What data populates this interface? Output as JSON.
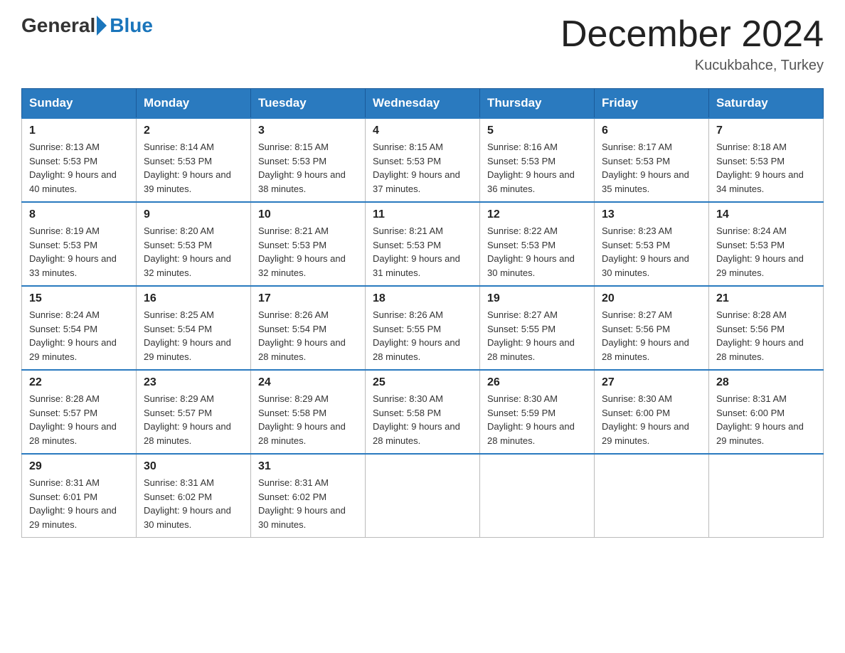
{
  "header": {
    "logo": {
      "general": "General",
      "blue": "Blue"
    },
    "title": "December 2024",
    "location": "Kucukbahce, Turkey"
  },
  "days_of_week": [
    "Sunday",
    "Monday",
    "Tuesday",
    "Wednesday",
    "Thursday",
    "Friday",
    "Saturday"
  ],
  "weeks": [
    [
      {
        "day": 1,
        "sunrise": "8:13 AM",
        "sunset": "5:53 PM",
        "daylight": "9 hours and 40 minutes."
      },
      {
        "day": 2,
        "sunrise": "8:14 AM",
        "sunset": "5:53 PM",
        "daylight": "9 hours and 39 minutes."
      },
      {
        "day": 3,
        "sunrise": "8:15 AM",
        "sunset": "5:53 PM",
        "daylight": "9 hours and 38 minutes."
      },
      {
        "day": 4,
        "sunrise": "8:15 AM",
        "sunset": "5:53 PM",
        "daylight": "9 hours and 37 minutes."
      },
      {
        "day": 5,
        "sunrise": "8:16 AM",
        "sunset": "5:53 PM",
        "daylight": "9 hours and 36 minutes."
      },
      {
        "day": 6,
        "sunrise": "8:17 AM",
        "sunset": "5:53 PM",
        "daylight": "9 hours and 35 minutes."
      },
      {
        "day": 7,
        "sunrise": "8:18 AM",
        "sunset": "5:53 PM",
        "daylight": "9 hours and 34 minutes."
      }
    ],
    [
      {
        "day": 8,
        "sunrise": "8:19 AM",
        "sunset": "5:53 PM",
        "daylight": "9 hours and 33 minutes."
      },
      {
        "day": 9,
        "sunrise": "8:20 AM",
        "sunset": "5:53 PM",
        "daylight": "9 hours and 32 minutes."
      },
      {
        "day": 10,
        "sunrise": "8:21 AM",
        "sunset": "5:53 PM",
        "daylight": "9 hours and 32 minutes."
      },
      {
        "day": 11,
        "sunrise": "8:21 AM",
        "sunset": "5:53 PM",
        "daylight": "9 hours and 31 minutes."
      },
      {
        "day": 12,
        "sunrise": "8:22 AM",
        "sunset": "5:53 PM",
        "daylight": "9 hours and 30 minutes."
      },
      {
        "day": 13,
        "sunrise": "8:23 AM",
        "sunset": "5:53 PM",
        "daylight": "9 hours and 30 minutes."
      },
      {
        "day": 14,
        "sunrise": "8:24 AM",
        "sunset": "5:53 PM",
        "daylight": "9 hours and 29 minutes."
      }
    ],
    [
      {
        "day": 15,
        "sunrise": "8:24 AM",
        "sunset": "5:54 PM",
        "daylight": "9 hours and 29 minutes."
      },
      {
        "day": 16,
        "sunrise": "8:25 AM",
        "sunset": "5:54 PM",
        "daylight": "9 hours and 29 minutes."
      },
      {
        "day": 17,
        "sunrise": "8:26 AM",
        "sunset": "5:54 PM",
        "daylight": "9 hours and 28 minutes."
      },
      {
        "day": 18,
        "sunrise": "8:26 AM",
        "sunset": "5:55 PM",
        "daylight": "9 hours and 28 minutes."
      },
      {
        "day": 19,
        "sunrise": "8:27 AM",
        "sunset": "5:55 PM",
        "daylight": "9 hours and 28 minutes."
      },
      {
        "day": 20,
        "sunrise": "8:27 AM",
        "sunset": "5:56 PM",
        "daylight": "9 hours and 28 minutes."
      },
      {
        "day": 21,
        "sunrise": "8:28 AM",
        "sunset": "5:56 PM",
        "daylight": "9 hours and 28 minutes."
      }
    ],
    [
      {
        "day": 22,
        "sunrise": "8:28 AM",
        "sunset": "5:57 PM",
        "daylight": "9 hours and 28 minutes."
      },
      {
        "day": 23,
        "sunrise": "8:29 AM",
        "sunset": "5:57 PM",
        "daylight": "9 hours and 28 minutes."
      },
      {
        "day": 24,
        "sunrise": "8:29 AM",
        "sunset": "5:58 PM",
        "daylight": "9 hours and 28 minutes."
      },
      {
        "day": 25,
        "sunrise": "8:30 AM",
        "sunset": "5:58 PM",
        "daylight": "9 hours and 28 minutes."
      },
      {
        "day": 26,
        "sunrise": "8:30 AM",
        "sunset": "5:59 PM",
        "daylight": "9 hours and 28 minutes."
      },
      {
        "day": 27,
        "sunrise": "8:30 AM",
        "sunset": "6:00 PM",
        "daylight": "9 hours and 29 minutes."
      },
      {
        "day": 28,
        "sunrise": "8:31 AM",
        "sunset": "6:00 PM",
        "daylight": "9 hours and 29 minutes."
      }
    ],
    [
      {
        "day": 29,
        "sunrise": "8:31 AM",
        "sunset": "6:01 PM",
        "daylight": "9 hours and 29 minutes."
      },
      {
        "day": 30,
        "sunrise": "8:31 AM",
        "sunset": "6:02 PM",
        "daylight": "9 hours and 30 minutes."
      },
      {
        "day": 31,
        "sunrise": "8:31 AM",
        "sunset": "6:02 PM",
        "daylight": "9 hours and 30 minutes."
      },
      null,
      null,
      null,
      null
    ]
  ]
}
